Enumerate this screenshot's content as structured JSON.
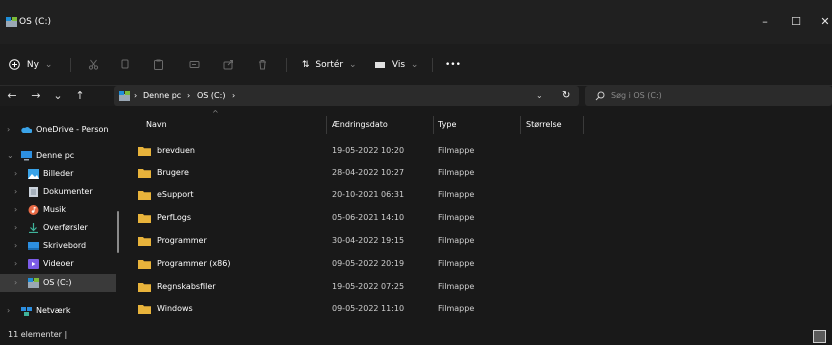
{
  "window": {
    "title": "OS (C:)",
    "controls": {
      "minimize": "–",
      "maximize": "☐",
      "close": "✕"
    }
  },
  "toolbar": {
    "new_label": "Ny",
    "sort_label": "Sortér",
    "view_label": "Vis",
    "more_label": "•••"
  },
  "address": {
    "crumbs": [
      "Denne pc",
      "OS (C:)"
    ],
    "separator": "›"
  },
  "search": {
    "placeholder": "Søg i OS (C:)"
  },
  "nav": {
    "items": [
      {
        "label": "OneDrive - Person",
        "icon": "onedrive-cloud-icon"
      },
      {
        "label": "Denne pc",
        "icon": "this-pc-icon"
      },
      {
        "label": "Billeder",
        "icon": "pictures-icon"
      },
      {
        "label": "Dokumenter",
        "icon": "documents-icon"
      },
      {
        "label": "Musik",
        "icon": "music-icon"
      },
      {
        "label": "Overførsler",
        "icon": "downloads-icon"
      },
      {
        "label": "Skrivebord",
        "icon": "desktop-icon"
      },
      {
        "label": "Videoer",
        "icon": "videos-icon"
      },
      {
        "label": "OS (C:)",
        "icon": "drive-icon"
      },
      {
        "label": "Netværk",
        "icon": "network-icon"
      }
    ]
  },
  "columns": {
    "name": "Navn",
    "date": "Ændringsdato",
    "type": "Type",
    "size": "Størrelse"
  },
  "files": [
    {
      "name": "brevduen",
      "date": "19-05-2022 10:20",
      "type": "Filmappe"
    },
    {
      "name": "Brugere",
      "date": "28-04-2022 10:27",
      "type": "Filmappe"
    },
    {
      "name": "eSupport",
      "date": "20-10-2021 06:31",
      "type": "Filmappe"
    },
    {
      "name": "PerfLogs",
      "date": "05-06-2021 14:10",
      "type": "Filmappe"
    },
    {
      "name": "Programmer",
      "date": "30-04-2022 19:15",
      "type": "Filmappe"
    },
    {
      "name": "Programmer (x86)",
      "date": "09-05-2022 20:19",
      "type": "Filmappe"
    },
    {
      "name": "Regnskabsfiler",
      "date": "19-05-2022 07:25",
      "type": "Filmappe"
    },
    {
      "name": "Windows",
      "date": "09-05-2022 11:10",
      "type": "Filmappe"
    }
  ],
  "status": {
    "count": "11 elementer  |"
  },
  "colors": {
    "folder": "#e8b33b",
    "background": "#191919",
    "accent": "#4cc2ff"
  }
}
